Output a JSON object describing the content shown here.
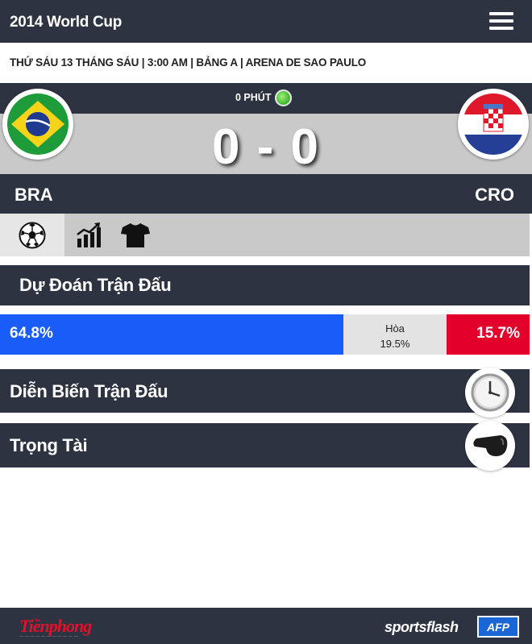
{
  "header": {
    "title": "2014 World Cup",
    "menu_icon": "hamburger-menu-icon"
  },
  "match_info": "THỨ SÁU 13 THÁNG SÁU | 3:00 AM | BẢNG A | ARENA DE SAO PAULO",
  "scoreboard": {
    "minute": "0 PHÚT",
    "status_color": "#3cb52a",
    "score": "0 - 0",
    "home": {
      "code": "BRA",
      "flag_icon": "brazil-flag-icon"
    },
    "away": {
      "code": "CRO",
      "flag_icon": "croatia-flag-icon"
    }
  },
  "tabs": [
    {
      "icon": "soccer-ball-icon",
      "active": true
    },
    {
      "icon": "stats-chart-icon",
      "active": false
    },
    {
      "icon": "jersey-icon",
      "active": false
    }
  ],
  "prediction": {
    "title": "Dự Đoán Trận Đấu",
    "home_label": "64.8%",
    "home_value": 64.8,
    "draw_title": "Hòa",
    "draw_label": "19.5%",
    "draw_value": 19.5,
    "away_label": "15.7%",
    "away_value": 15.7,
    "colors": {
      "home": "#1a5cf8",
      "draw": "#e3e3e3",
      "away": "#e3002a"
    }
  },
  "sections": {
    "events": {
      "title": "Diễn Biến Trận Đấu",
      "icon": "clock-icon"
    },
    "referee": {
      "title": "Trọng Tài",
      "icon": "whistle-icon"
    }
  },
  "footer": {
    "tienphong": "Tiềnphong",
    "sportsflash": "sportsflash",
    "afp": "AFP"
  }
}
